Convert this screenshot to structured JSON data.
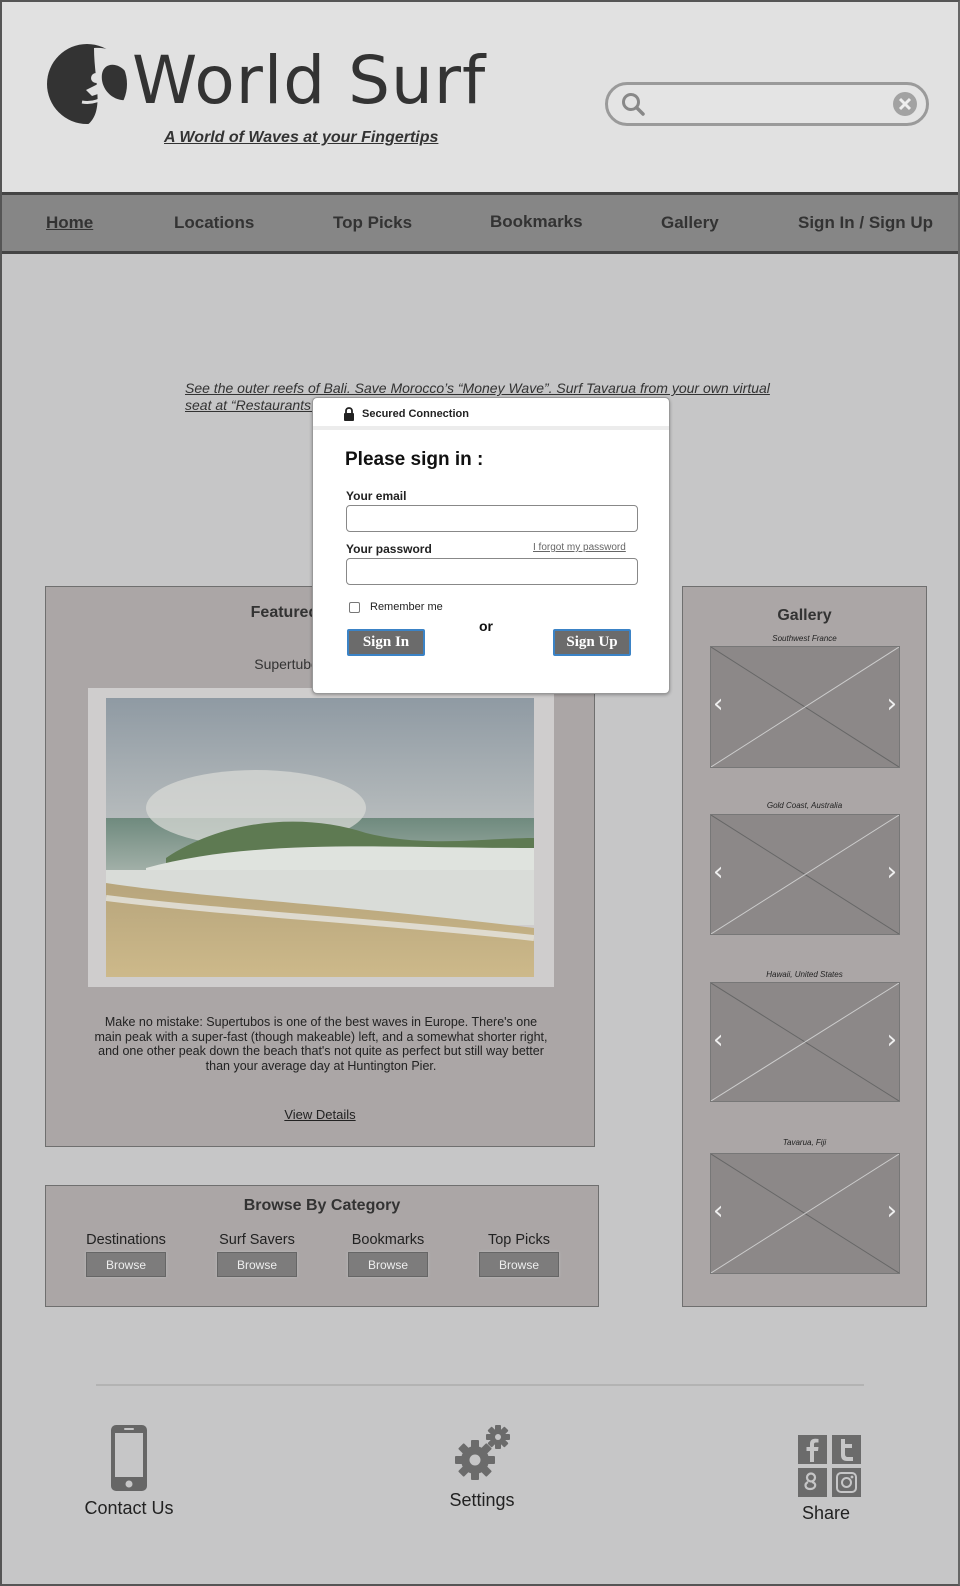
{
  "header": {
    "brand": "World Surf",
    "tagline": "A World of Waves at your Fingertips",
    "search_placeholder": ""
  },
  "nav": {
    "items": [
      "Home",
      "Locations",
      "Top Picks",
      "Bookmarks",
      "Gallery",
      "Sign In / Sign Up"
    ],
    "active": "Home"
  },
  "intro": "See the outer reefs of Bali. Save Morocco’s “Money Wave”. Surf Tavarua from your own virtual seat at “Restaurants”",
  "featured": {
    "title": "Featured Location",
    "subtitle": "Supertubos, Portugal",
    "description": "Make no mistake: Supertubos is one of the best waves in Europe. There's one main peak with a super-fast (though makeable) left, and a somewhat shorter right, and one other peak down the beach that's not quite as perfect but still way better than your average day at Huntington Pier.",
    "view_details": "View Details"
  },
  "browse": {
    "title": "Browse By Category",
    "categories": [
      "Destinations",
      "Surf Savers",
      "Bookmarks",
      "Top Picks"
    ],
    "button_label": "Browse"
  },
  "gallery": {
    "title": "Gallery",
    "captions": [
      "Southwest France",
      "Gold Coast, Australia",
      "Hawaii, United States",
      "Tavarua, Fiji"
    ],
    "prev_arrow": "‹",
    "next_arrow": "›"
  },
  "footer": {
    "contact": "Contact Us",
    "settings": "Settings",
    "share": "Share"
  },
  "modal": {
    "header_label": "Secured Connection",
    "title": "Please sign in :",
    "email_label": "Your email",
    "email_value": "",
    "password_label": "Your password",
    "password_value": "",
    "forgot_link": "I forgot my password",
    "remember_label": "Remember me",
    "or_text": "or",
    "signin_label": "Sign In",
    "signup_label": "Sign Up"
  },
  "colors": {
    "page_bg": "#c6c6c7",
    "header_bg": "#e1e1e1",
    "nav_bg": "#868686",
    "panel_bg": "#aba6a6",
    "button_accent_border": "#3b83c6",
    "button_bg": "#6b6b6b"
  },
  "icons": [
    "logo-wave-icon",
    "search-icon",
    "clear-icon",
    "lock-icon",
    "phone-icon",
    "gears-icon",
    "facebook-icon",
    "twitter-icon",
    "google-plus-icon",
    "instagram-icon"
  ]
}
